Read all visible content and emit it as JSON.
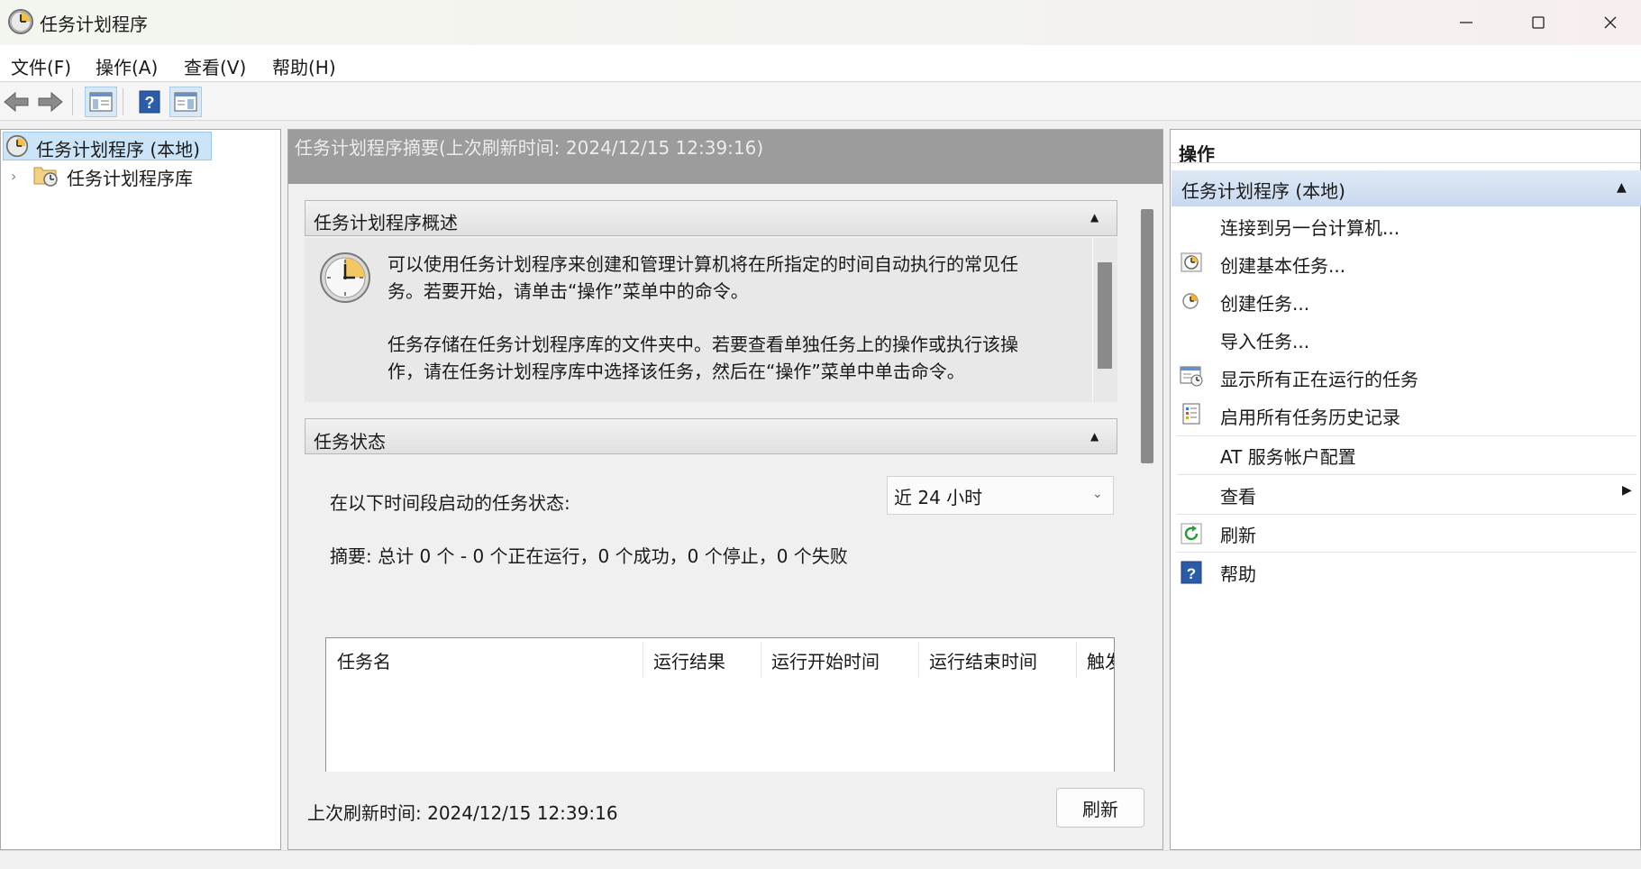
{
  "window": {
    "title": "任务计划程序"
  },
  "menu": [
    "文件(F)",
    "操作(A)",
    "查看(V)",
    "帮助(H)"
  ],
  "tree": {
    "root": "任务计划程序 (本地)",
    "child": "任务计划程序库"
  },
  "center": {
    "header": "任务计划程序摘要(上次刷新时间: 2024/12/15 12:39:16)",
    "overview": {
      "title": "任务计划程序概述",
      "para1_line1": "可以使用任务计划程序来创建和管理计算机将在所指定的时间自动执行的常见任",
      "para1_line2": "务。若要开始，请单击“操作”菜单中的命令。",
      "para2_line1": "任务存储在任务计划程序库的文件夹中。若要查看单独任务上的操作或执行该操",
      "para2_line2": "作，请在任务计划程序库中选择该任务，然后在“操作”菜单中单击命令。"
    },
    "status": {
      "title": "任务状态",
      "label": "在以下时间段启动的任务状态:",
      "range": "近 24 小时",
      "summary": "摘要: 总计 0 个 - 0 个正在运行，0 个成功，0 个停止，0 个失败",
      "columns": [
        "任务名",
        "运行结果",
        "运行开始时间",
        "运行结束时间",
        "触发"
      ]
    },
    "footer": {
      "last_refresh": "上次刷新时间: 2024/12/15 12:39:16",
      "refresh_button": "刷新"
    }
  },
  "actions": {
    "title": "操作",
    "group": "任务计划程序 (本地)",
    "items": [
      {
        "label": "连接到另一台计算机...",
        "icon": "none"
      },
      {
        "label": "创建基本任务...",
        "icon": "basic-task-icon"
      },
      {
        "label": "创建任务...",
        "icon": "create-task-icon"
      },
      {
        "label": "导入任务...",
        "icon": "none"
      },
      {
        "label": "显示所有正在运行的任务",
        "icon": "running-tasks-icon"
      },
      {
        "label": "启用所有任务历史记录",
        "icon": "history-icon"
      },
      {
        "label": "AT 服务帐户配置",
        "icon": "none"
      },
      {
        "label": "查看",
        "icon": "none"
      },
      {
        "label": "刷新",
        "icon": "refresh-icon"
      },
      {
        "label": "帮助",
        "icon": "help-icon"
      }
    ]
  },
  "colors": {
    "center_header": "#9c9c9c",
    "selection": "#cce4f7",
    "actions_group": "#c8d9ef",
    "help_blue": "#2a5caa"
  }
}
